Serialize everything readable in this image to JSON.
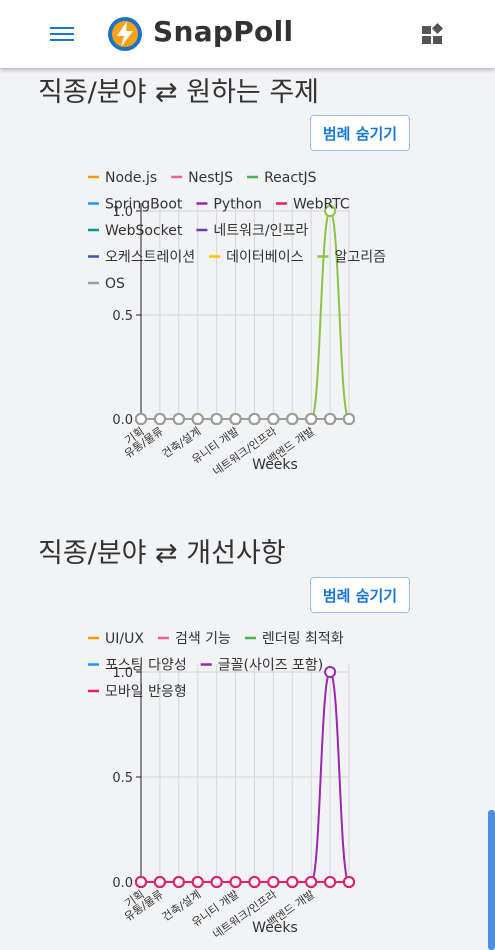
{
  "app": {
    "brand": "SnapPoll",
    "icons": {
      "menu": "menu-icon",
      "logo": "lightning-logo-icon",
      "widgets": "widgets-icon"
    }
  },
  "sections": [
    {
      "title": "직종/분야 ⇄ 원하는 주제",
      "legend_toggle_label": "범례 숨기기"
    },
    {
      "title": "직종/분야 ⇄ 개선사항",
      "legend_toggle_label": "범례 숨기기"
    }
  ],
  "chart_data": [
    {
      "type": "line",
      "xlabel": "Weeks",
      "ylim": [
        0,
        1
      ],
      "y_ticks": [
        "0.0",
        "0.5",
        "1.0"
      ],
      "grid": true,
      "legend_placement": "top",
      "categories": [
        "기획",
        "유통/물류",
        "",
        "건축/설계",
        "",
        "유니티 개발",
        "",
        "네트워크/인프라",
        "",
        "백엔드 개발",
        "",
        ""
      ],
      "series": [
        {
          "name": "Node.js",
          "color": "#ff9800",
          "values": [
            0,
            0,
            0,
            0,
            0,
            0,
            0,
            0,
            0,
            0,
            0,
            0
          ]
        },
        {
          "name": "NestJS",
          "color": "#f06292",
          "values": [
            0,
            0,
            0,
            0,
            0,
            0,
            0,
            0,
            0,
            0,
            0,
            0
          ]
        },
        {
          "name": "ReactJS",
          "color": "#4caf50",
          "values": [
            0,
            0,
            0,
            0,
            0,
            0,
            0,
            0,
            0,
            0,
            0,
            0
          ]
        },
        {
          "name": "SpringBoot",
          "color": "#2196f3",
          "values": [
            0,
            0,
            0,
            0,
            0,
            0,
            0,
            0,
            0,
            0,
            0,
            0
          ]
        },
        {
          "name": "Python",
          "color": "#9c27b0",
          "values": [
            0,
            0,
            0,
            0,
            0,
            0,
            0,
            0,
            0,
            0,
            0,
            0
          ]
        },
        {
          "name": "WebRTC",
          "color": "#e91e63",
          "values": [
            0,
            0,
            0,
            0,
            0,
            0,
            0,
            0,
            0,
            0,
            0,
            0
          ]
        },
        {
          "name": "WebSocket",
          "color": "#009688",
          "values": [
            0,
            0,
            0,
            0,
            0,
            0,
            0,
            0,
            0,
            0,
            0,
            0
          ]
        },
        {
          "name": "네트워크/인프라",
          "color": "#673ab7",
          "values": [
            0,
            0,
            0,
            0,
            0,
            0,
            0,
            0,
            0,
            0,
            0,
            0
          ]
        },
        {
          "name": "오케스트레이션",
          "color": "#3f51b5",
          "values": [
            0,
            0,
            0,
            0,
            0,
            0,
            0,
            0,
            0,
            0,
            0,
            0
          ]
        },
        {
          "name": "데이터베이스",
          "color": "#ffc107",
          "values": [
            0,
            0,
            0,
            0,
            0,
            0,
            0,
            0,
            0,
            0,
            0,
            0
          ]
        },
        {
          "name": "알고리즘",
          "color": "#8bc34a",
          "values": [
            0,
            0,
            0,
            0,
            0,
            0,
            0,
            0,
            0,
            0,
            1,
            0
          ]
        },
        {
          "name": "OS",
          "color": "#9e9e9e",
          "values": [
            0,
            0,
            0,
            0,
            0,
            0,
            0,
            0,
            0,
            0,
            0,
            0
          ]
        }
      ]
    },
    {
      "type": "line",
      "xlabel": "Weeks",
      "ylim": [
        0,
        1
      ],
      "y_ticks": [
        "0.0",
        "0.5",
        "1.0"
      ],
      "grid": true,
      "legend_placement": "top",
      "categories": [
        "기획",
        "유통/물류",
        "",
        "건축/설계",
        "",
        "유니티 개발",
        "",
        "네트워크/인프라",
        "",
        "백엔드 개발",
        "",
        ""
      ],
      "series": [
        {
          "name": "UI/UX",
          "color": "#ff9800",
          "values": [
            0,
            0,
            0,
            0,
            0,
            0,
            0,
            0,
            0,
            0,
            0,
            0
          ]
        },
        {
          "name": "검색 기능",
          "color": "#f06292",
          "values": [
            0,
            0,
            0,
            0,
            0,
            0,
            0,
            0,
            0,
            0,
            0,
            0
          ]
        },
        {
          "name": "렌더링 최적화",
          "color": "#4caf50",
          "values": [
            0,
            0,
            0,
            0,
            0,
            0,
            0,
            0,
            0,
            0,
            0,
            0
          ]
        },
        {
          "name": "포스팅 다양성",
          "color": "#2196f3",
          "values": [
            0,
            0,
            0,
            0,
            0,
            0,
            0,
            0,
            0,
            0,
            0,
            0
          ]
        },
        {
          "name": "글꼴(사이즈 포함)",
          "color": "#9c27b0",
          "values": [
            0,
            0,
            0,
            0,
            0,
            0,
            0,
            0,
            0,
            0,
            1,
            0
          ]
        },
        {
          "name": "모바일 반응형",
          "color": "#e91e63",
          "values": [
            0,
            0,
            0,
            0,
            0,
            0,
            0,
            0,
            0,
            0,
            0,
            0
          ]
        }
      ]
    }
  ]
}
